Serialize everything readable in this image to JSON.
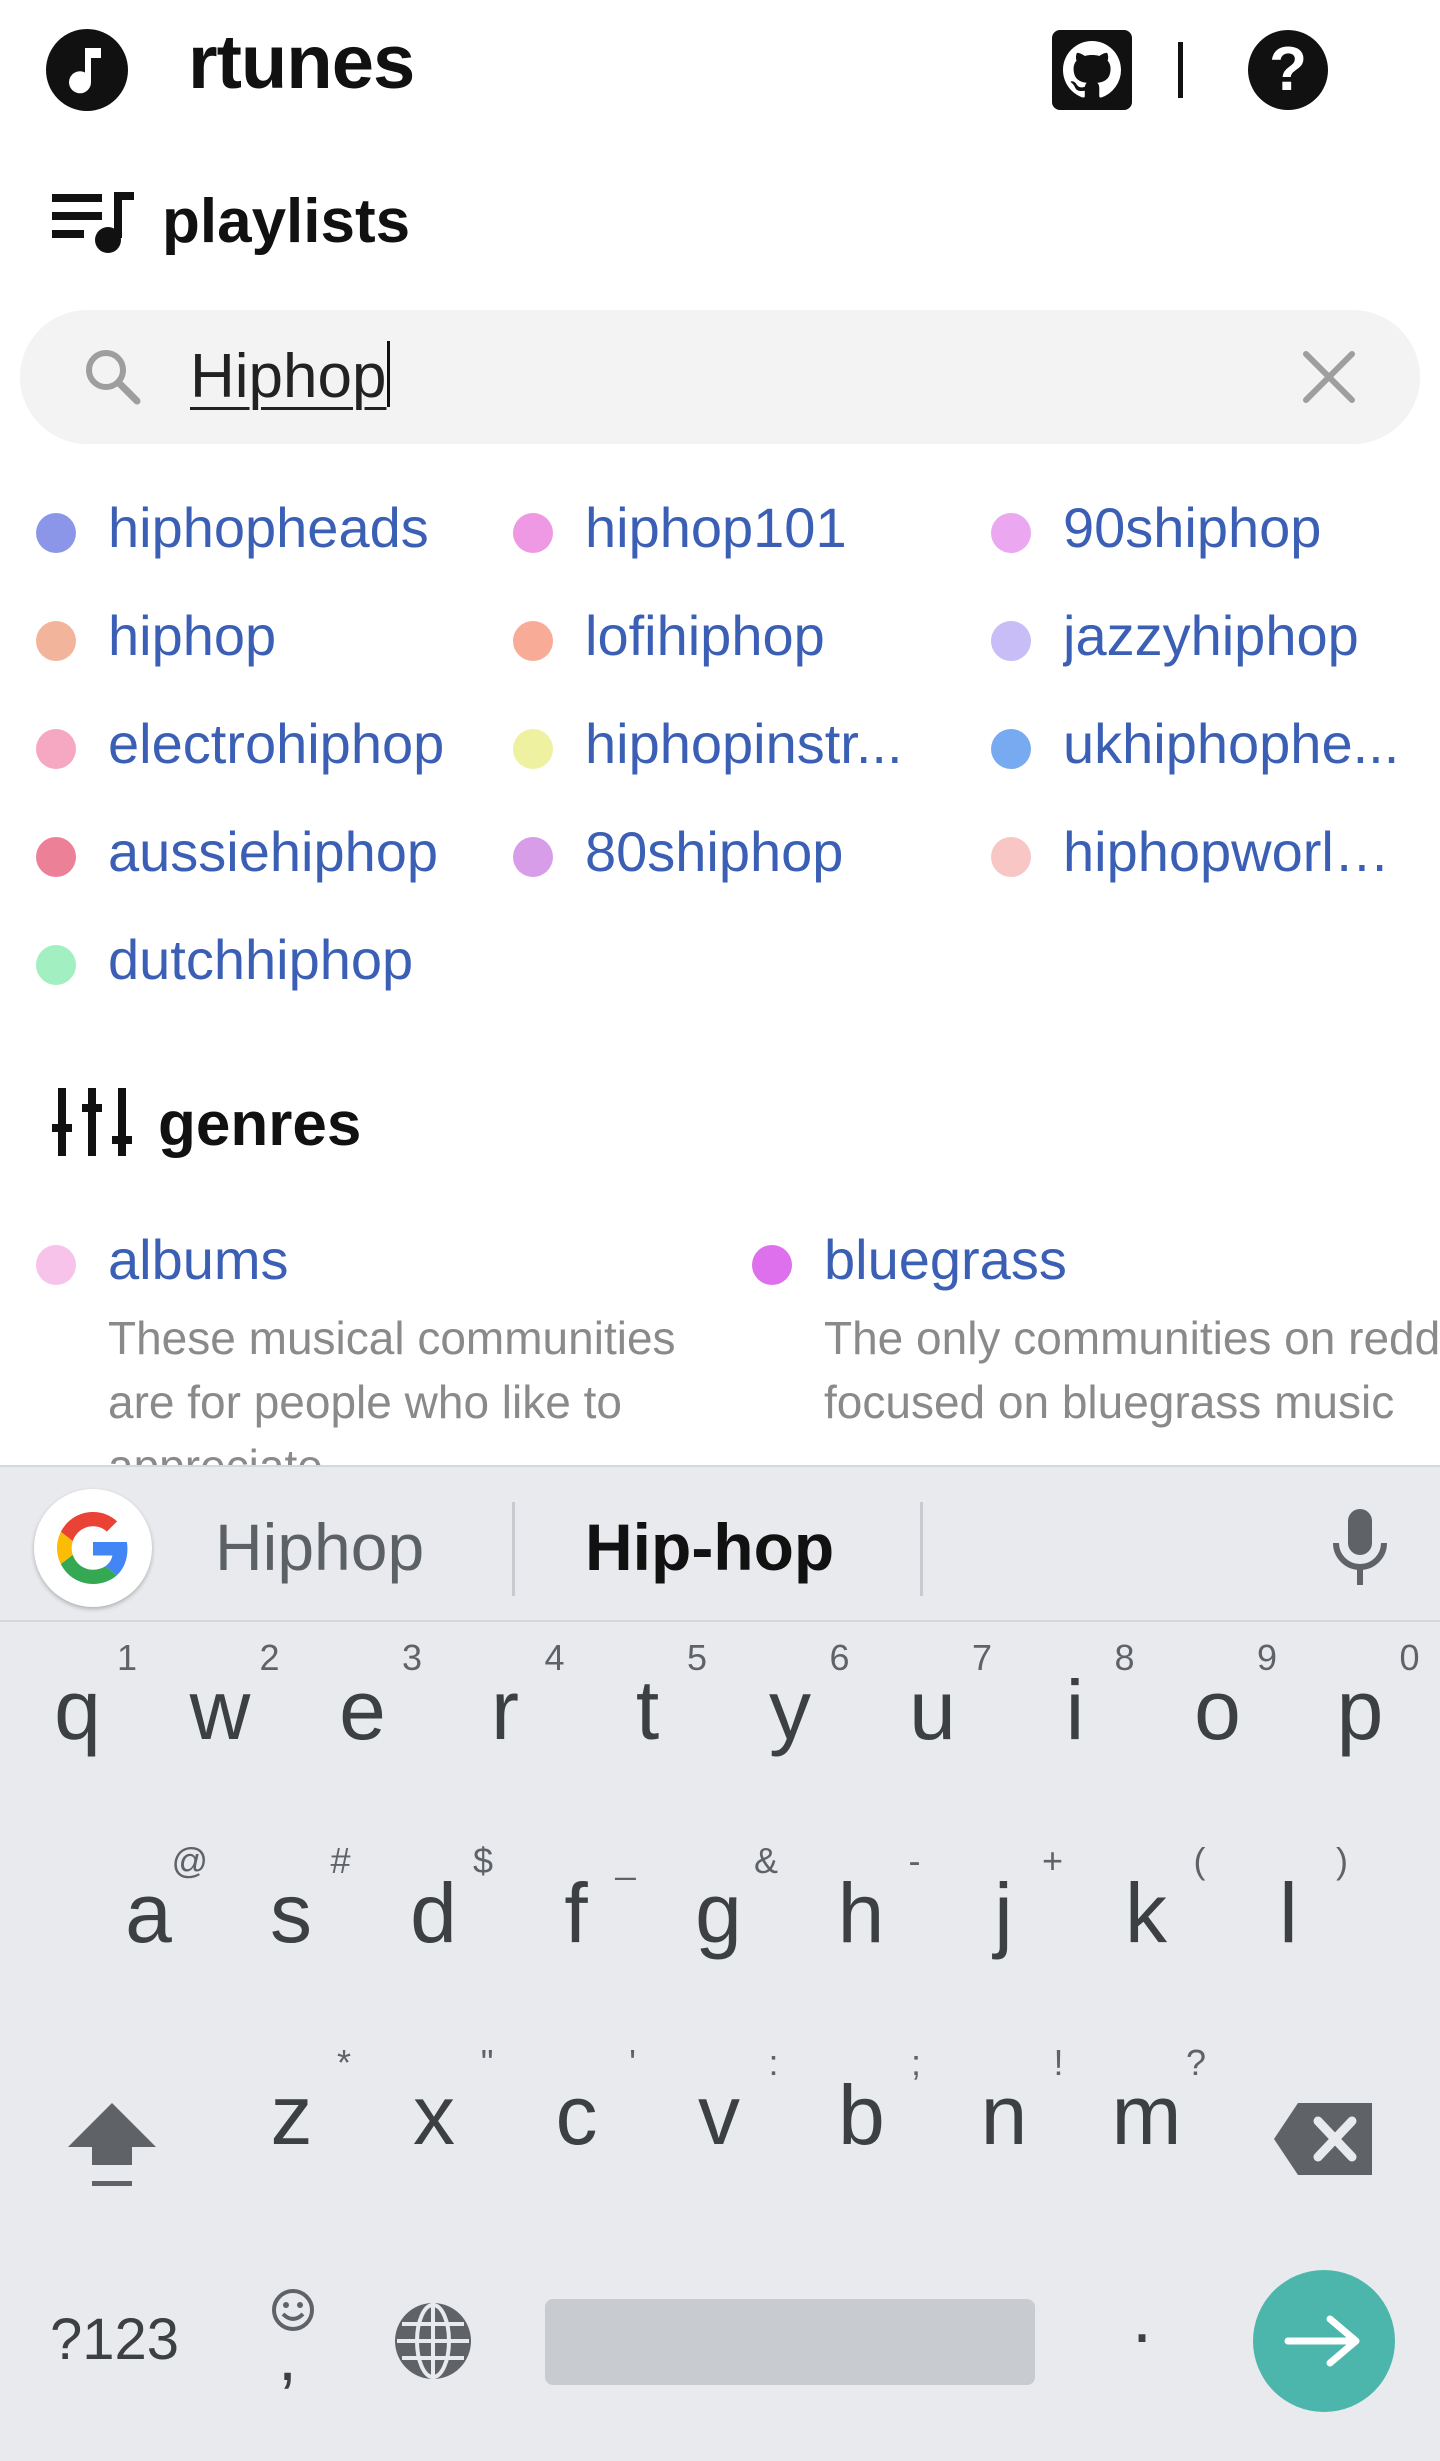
{
  "header": {
    "title": "rtunes",
    "logo_icon": "music-note-icon",
    "github_icon": "github-icon",
    "help_label": "?"
  },
  "playlists_section": {
    "heading": "playlists",
    "icon": "playlist-music-icon"
  },
  "search": {
    "value": "Hiphop",
    "clear_icon": "close-icon"
  },
  "playlists": [
    {
      "name": "hiphopheads",
      "color": "#8b96e9"
    },
    {
      "name": "hiphop101",
      "color": "#ef98e3"
    },
    {
      "name": "90shiphop",
      "color": "#eba7ef"
    },
    {
      "name": "hiphop",
      "color": "#f2b59c"
    },
    {
      "name": "lofihiphop",
      "color": "#f8ab96"
    },
    {
      "name": "jazzyhiphop",
      "color": "#c8bdf7"
    },
    {
      "name": "electrohiphop",
      "color": "#f6a8c2"
    },
    {
      "name": "hiphopinstr...",
      "color": "#eef2a0"
    },
    {
      "name": "ukhiphophe...",
      "color": "#77aaf0"
    },
    {
      "name": "aussiehiphop",
      "color": "#ec8096"
    },
    {
      "name": "80shiphop",
      "color": "#d79de9"
    },
    {
      "name": "hiphopworld...",
      "color": "#f9c6c6"
    },
    {
      "name": "dutchhiphop",
      "color": "#a2f0c2"
    }
  ],
  "genres_section": {
    "heading": "genres",
    "icon": "tune-sliders-icon"
  },
  "genres": [
    {
      "name": "albums",
      "color": "#f7c3ea",
      "description": "These musical communities are for people who like to appreciate"
    },
    {
      "name": "bluegrass",
      "color": "#de70ee",
      "description": "The only communities on reddit focused on bluegrass music"
    }
  ],
  "keyboard": {
    "suggestions": [
      "Hiphop",
      "Hip-hop"
    ],
    "row1": [
      {
        "key": "q",
        "alt": "1"
      },
      {
        "key": "w",
        "alt": "2"
      },
      {
        "key": "e",
        "alt": "3"
      },
      {
        "key": "r",
        "alt": "4"
      },
      {
        "key": "t",
        "alt": "5"
      },
      {
        "key": "y",
        "alt": "6"
      },
      {
        "key": "u",
        "alt": "7"
      },
      {
        "key": "i",
        "alt": "8"
      },
      {
        "key": "o",
        "alt": "9"
      },
      {
        "key": "p",
        "alt": "0"
      }
    ],
    "row2": [
      {
        "key": "a",
        "alt": "@"
      },
      {
        "key": "s",
        "alt": "#"
      },
      {
        "key": "d",
        "alt": "$"
      },
      {
        "key": "f",
        "alt": "_"
      },
      {
        "key": "g",
        "alt": "&"
      },
      {
        "key": "h",
        "alt": "-"
      },
      {
        "key": "j",
        "alt": "+"
      },
      {
        "key": "k",
        "alt": "("
      },
      {
        "key": "l",
        "alt": ")"
      }
    ],
    "row3": [
      {
        "key": "z",
        "alt": "*"
      },
      {
        "key": "x",
        "alt": "\""
      },
      {
        "key": "c",
        "alt": "'"
      },
      {
        "key": "v",
        "alt": ":"
      },
      {
        "key": "b",
        "alt": ";"
      },
      {
        "key": "n",
        "alt": "!"
      },
      {
        "key": "m",
        "alt": "?"
      }
    ],
    "symbols_label": "?123",
    "comma_label": ",",
    "period_label": ".",
    "icons": [
      "shift-icon",
      "backspace-icon",
      "emoji-icon",
      "globe-icon",
      "mic-icon",
      "enter-arrow-icon",
      "google-g-icon"
    ]
  }
}
